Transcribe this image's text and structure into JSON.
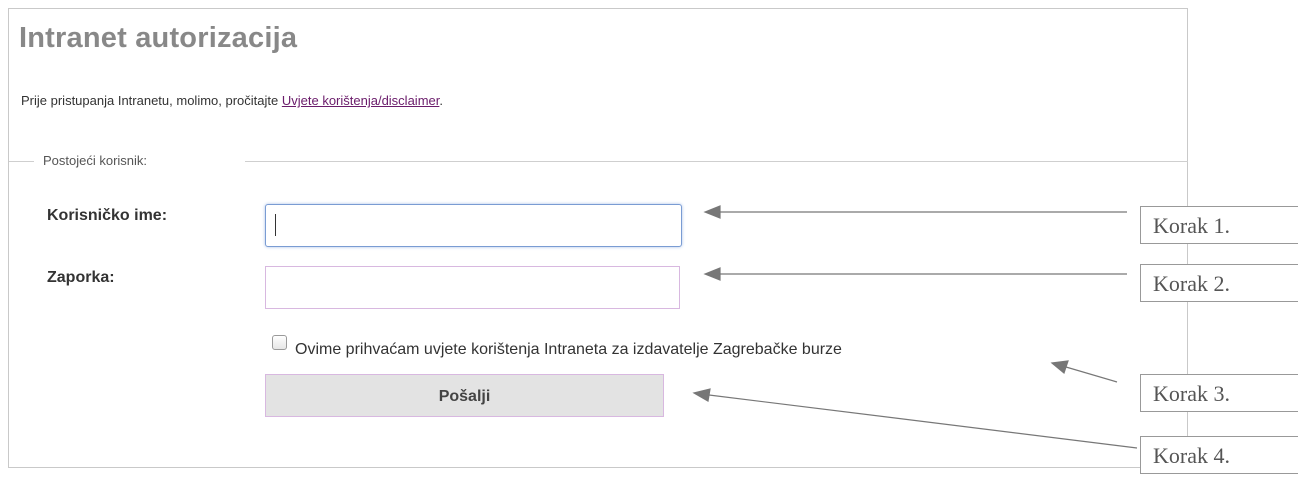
{
  "form": {
    "title": "Intranet autorizacija",
    "intro_text": "Prije pristupanja Intranetu, molimo, pročitajte ",
    "intro_link": "Uvjete korištenja/disclaimer",
    "intro_suffix": ".",
    "legend": "Postojeći korisnik:",
    "username_label": "Korisničko ime:",
    "username_value": "",
    "password_label": "Zaporka:",
    "password_value": "",
    "terms_checked": false,
    "terms_label": "Ovime prihvaćam uvjete korištenja Intraneta za izdavatelje Zagrebačke burze",
    "submit_label": "Pošalji"
  },
  "annotations": {
    "steps": [
      {
        "label": "Korak 1."
      },
      {
        "label": "Korak 2."
      },
      {
        "label": "Korak 3."
      },
      {
        "label": "Korak 4."
      }
    ]
  },
  "colors": {
    "title": "#888888",
    "link": "#6a1b6a",
    "focus_border": "#7a9cd3",
    "input_border": "#d8b8e0",
    "button_bg": "#e3e3e3",
    "arrow": "#777777"
  }
}
